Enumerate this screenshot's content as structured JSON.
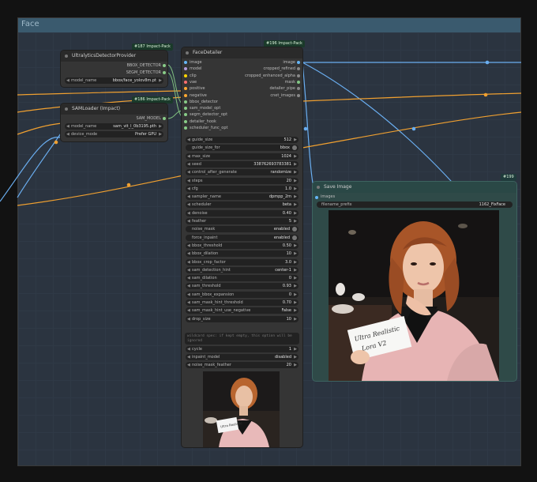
{
  "group": {
    "title": "Face"
  },
  "nodes": {
    "ultralytics": {
      "title": "UltralyticsDetectorProvider",
      "badge": "#187 Impact-Pack",
      "outputs": [
        "BBOX_DETECTOR",
        "SEGM_DETECTOR"
      ],
      "widgets": [
        {
          "label": "model_name",
          "value": "bbox/face_yolov8m.pt"
        }
      ]
    },
    "samloader": {
      "title": "SAMLoader (Impact)",
      "badge": "#186 Impact-Pack",
      "outputs": [
        "SAM_MODEL"
      ],
      "widgets": [
        {
          "label": "model_name",
          "value": "sam_vit_l_0b3195.pth"
        },
        {
          "label": "device_mode",
          "value": "Prefer GPU"
        }
      ]
    },
    "facedetailer": {
      "title": "FaceDetailer",
      "badge": "#196 Impact-Pack",
      "inputs": [
        "image",
        "model",
        "clip",
        "vae",
        "positive",
        "negative",
        "bbox_detector",
        "sam_model_opt",
        "segm_detector_opt",
        "detailer_hook",
        "scheduler_func_opt"
      ],
      "outputs": [
        "image",
        "cropped_refined",
        "cropped_enhanced_alpha",
        "mask",
        "detailer_pipe",
        "cnet_images"
      ],
      "widgets": [
        {
          "label": "guide_size",
          "value": "512",
          "kind": "num"
        },
        {
          "label": "guide_size_for",
          "value": "bbox",
          "kind": "toggle"
        },
        {
          "label": "max_size",
          "value": "1024",
          "kind": "num"
        },
        {
          "label": "seed",
          "value": "338762693783381",
          "kind": "num"
        },
        {
          "label": "control_after_generate",
          "value": "randomize",
          "kind": "num"
        },
        {
          "label": "steps",
          "value": "20",
          "kind": "num"
        },
        {
          "label": "cfg",
          "value": "1.0",
          "kind": "num"
        },
        {
          "label": "sampler_name",
          "value": "dpmpp_2m",
          "kind": "num"
        },
        {
          "label": "scheduler",
          "value": "beta",
          "kind": "num"
        },
        {
          "label": "denoise",
          "value": "0.40",
          "kind": "num"
        },
        {
          "label": "feather",
          "value": "5",
          "kind": "num"
        },
        {
          "label": "noise_mask",
          "value": "enabled",
          "kind": "toggle"
        },
        {
          "label": "force_inpaint",
          "value": "enabled",
          "kind": "toggle"
        },
        {
          "label": "bbox_threshold",
          "value": "0.50",
          "kind": "num"
        },
        {
          "label": "bbox_dilation",
          "value": "10",
          "kind": "num"
        },
        {
          "label": "bbox_crop_factor",
          "value": "3.0",
          "kind": "num"
        },
        {
          "label": "sam_detection_hint",
          "value": "center-1",
          "kind": "num"
        },
        {
          "label": "sam_dilation",
          "value": "0",
          "kind": "num"
        },
        {
          "label": "sam_threshold",
          "value": "0.93",
          "kind": "num"
        },
        {
          "label": "sam_bbox_expansion",
          "value": "0",
          "kind": "num"
        },
        {
          "label": "sam_mask_hint_threshold",
          "value": "0.70",
          "kind": "num"
        },
        {
          "label": "sam_mask_hint_use_negative",
          "value": "False",
          "kind": "num"
        },
        {
          "label": "drop_size",
          "value": "10",
          "kind": "num"
        }
      ],
      "wildcard_text": "wildcard spec: if kept empty, this option will be ignored",
      "widgets2": [
        {
          "label": "cycle",
          "value": "1"
        },
        {
          "label": "inpaint_model",
          "value": "disabled"
        },
        {
          "label": "noise_mask_feather",
          "value": "20"
        }
      ]
    },
    "saveimage": {
      "title": "Save Image",
      "badge": "#199",
      "inputs": [
        "images"
      ],
      "widgets": [
        {
          "label": "filename_prefix",
          "value": "1162_FixFace"
        }
      ]
    }
  },
  "photo": {
    "card_text": [
      "Ultra Realistic",
      "Lora  V2"
    ]
  },
  "colors": {
    "image": "#64b5f6",
    "model": "#b39ddb",
    "clip": "#ffd500",
    "vae": "#ff6e6e",
    "conditioning": "#ffa931",
    "detector": "#88cc88",
    "canvas": "#2b3440"
  }
}
